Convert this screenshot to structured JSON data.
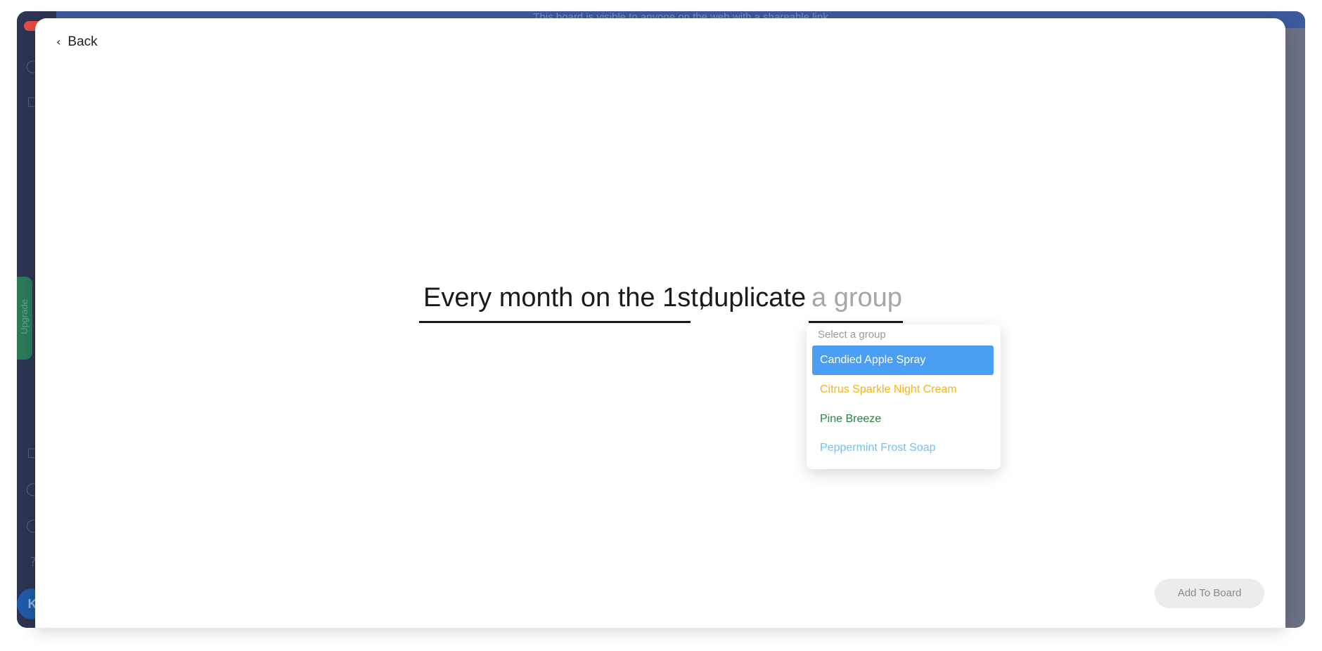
{
  "background": {
    "banner_text": "This board is visible to anyone on the web with a shareable link",
    "upgrade_label": "Upgrade",
    "avatar_initial": "K"
  },
  "modal": {
    "back_label": "Back",
    "back_icon": "chevron-left-icon",
    "sentence": {
      "trigger": "Every month on the 1st,",
      "action": "duplicate",
      "group_placeholder": "a group"
    },
    "dropdown": {
      "header": "Select a group",
      "options": [
        {
          "label": "Candied Apple Spray",
          "color": "#ffffff",
          "selected": true,
          "highlight": "#4a9ff5"
        },
        {
          "label": "Citrus Sparkle Night Cream",
          "color": "#f5b21c",
          "selected": false
        },
        {
          "label": "Pine Breeze",
          "color": "#2e7d44",
          "selected": false
        },
        {
          "label": "Peppermint Frost Soap",
          "color": "#6fc2f2",
          "selected": false
        }
      ]
    },
    "add_button_label": "Add To Board"
  }
}
